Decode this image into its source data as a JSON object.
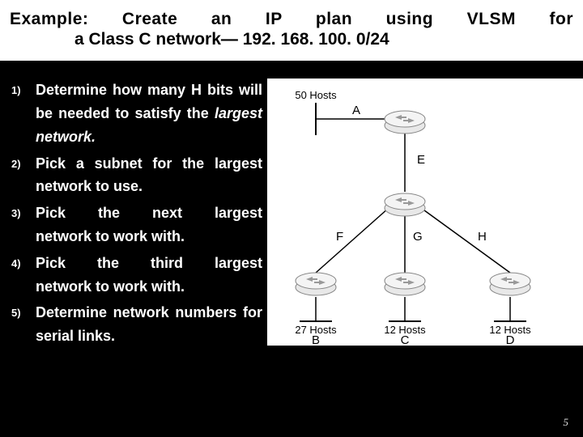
{
  "header": {
    "line1": "Example:  Create  an  IP  plan  using  VLSM  for",
    "line2": "a Class C network— 192. 168. 100. 0/24"
  },
  "steps": [
    {
      "num": "1)",
      "text_a": "Determine how many H bits",
      "text_b": "will be needed to satisfy the",
      "text_c": "largest network.",
      "italic_c": true
    },
    {
      "num": "2)",
      "text_a": "Pick a subnet for the largest",
      "text_b": "network to use.",
      "text_c": ""
    },
    {
      "num": "3)",
      "text_a": "Pick    the    next    largest",
      "text_b": "network to work with.",
      "text_c": ""
    },
    {
      "num": "4)",
      "text_a": "Pick    the    third    largest",
      "text_b": "network to work with.",
      "text_c": ""
    },
    {
      "num": "5)",
      "text_a": "Determine network numbers",
      "text_b": "for serial links.",
      "text_c": ""
    }
  ],
  "diagram": {
    "host_a": "50 Hosts",
    "label_a": "A",
    "label_e": "E",
    "label_f": "F",
    "label_g": "G",
    "label_h": "H",
    "host_b": "27 Hosts",
    "label_b": "B",
    "host_c": "12 Hosts",
    "label_c": "C",
    "host_d": "12 Hosts",
    "label_d": "D"
  },
  "page_number": "5"
}
